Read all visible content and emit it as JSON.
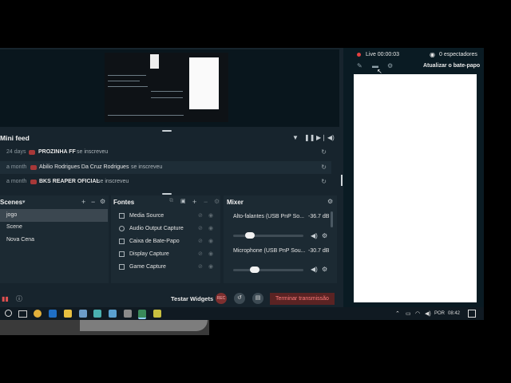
{
  "stream": {
    "live_label": "Live 00:00:03",
    "viewers_label": "0 espectadores",
    "refresh_chat_label": "Atualizar o bate-papo"
  },
  "mini_feed": {
    "title": "Mini feed",
    "rows": [
      {
        "time": "24 days",
        "name": "PROZINHA FF",
        "action": "se inscreveu"
      },
      {
        "time": "a month",
        "name": "Abilio Rodrigues Da Cruz Rodrigues",
        "action": "se inscreveu"
      },
      {
        "time": "a month",
        "name": "BKS REAPER OFICIAL",
        "action": "se inscreveu"
      }
    ]
  },
  "scenes": {
    "title": "Scenes",
    "items": [
      "jogo",
      "Scene",
      "Nova Cena"
    ],
    "selected": "jogo"
  },
  "sources": {
    "title": "Fontes",
    "items": [
      "Media Source",
      "Audio Output Capture",
      "Caixa de Bate-Papo",
      "Display Capture",
      "Game Capture"
    ]
  },
  "mixer": {
    "title": "Mixer",
    "channels": [
      {
        "name": "Alto-falantes (USB PnP So...",
        "db": "-36.7 dB",
        "level": 0.2
      },
      {
        "name": "Microphone (USB PnP Sou...",
        "db": "-30.7 dB",
        "level": 0.28
      }
    ]
  },
  "bottom": {
    "test_widgets": "Testar Widgets",
    "rec_label": "REC",
    "end_stream": "Terminar transmissão"
  },
  "taskbar": {
    "lang": "POR",
    "time": "08:42"
  },
  "colors": {
    "live": "#e54040",
    "end_stream_text": "#ff7a7a",
    "panel_bg": "#1c2a33"
  }
}
